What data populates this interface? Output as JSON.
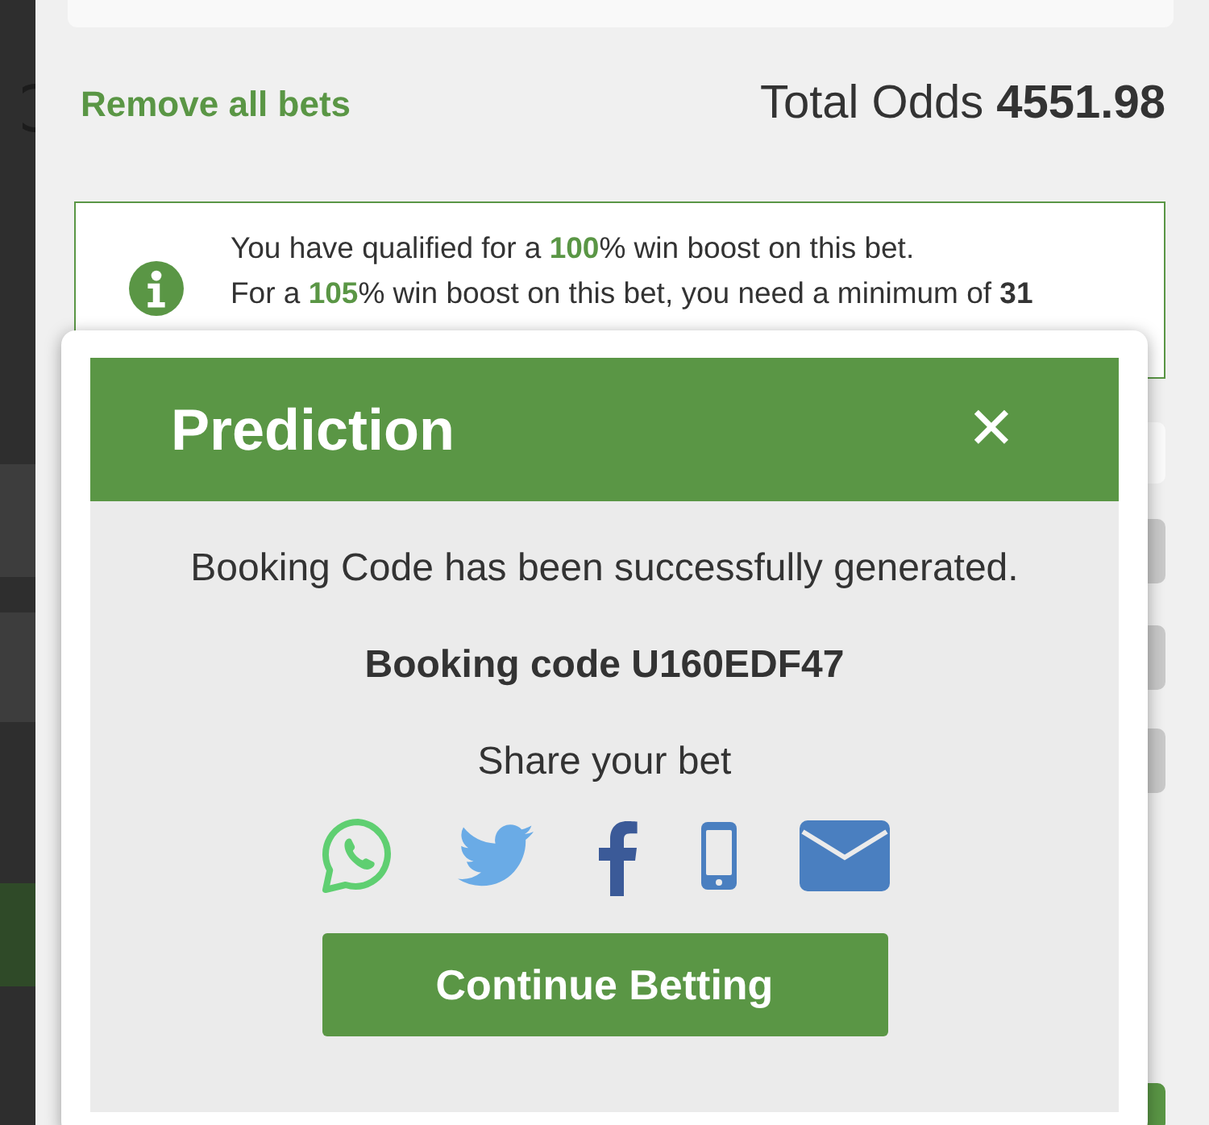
{
  "summary": {
    "remove_link": "Remove all bets",
    "total_label": "Total Odds",
    "total_value": "4551.98"
  },
  "notice": {
    "lines": [
      "You have qualified for a **100**% win boost on this bet.",
      "For a **105**% win boost on this bet, you need a minimum of **31**"
    ]
  },
  "dialog": {
    "title": "Prediction",
    "close": "✕",
    "message": "Booking Code has been successfully generated.",
    "code_label": "Booking code U160EDF47",
    "share_label": "Share your bet",
    "button": "Continue Betting"
  }
}
